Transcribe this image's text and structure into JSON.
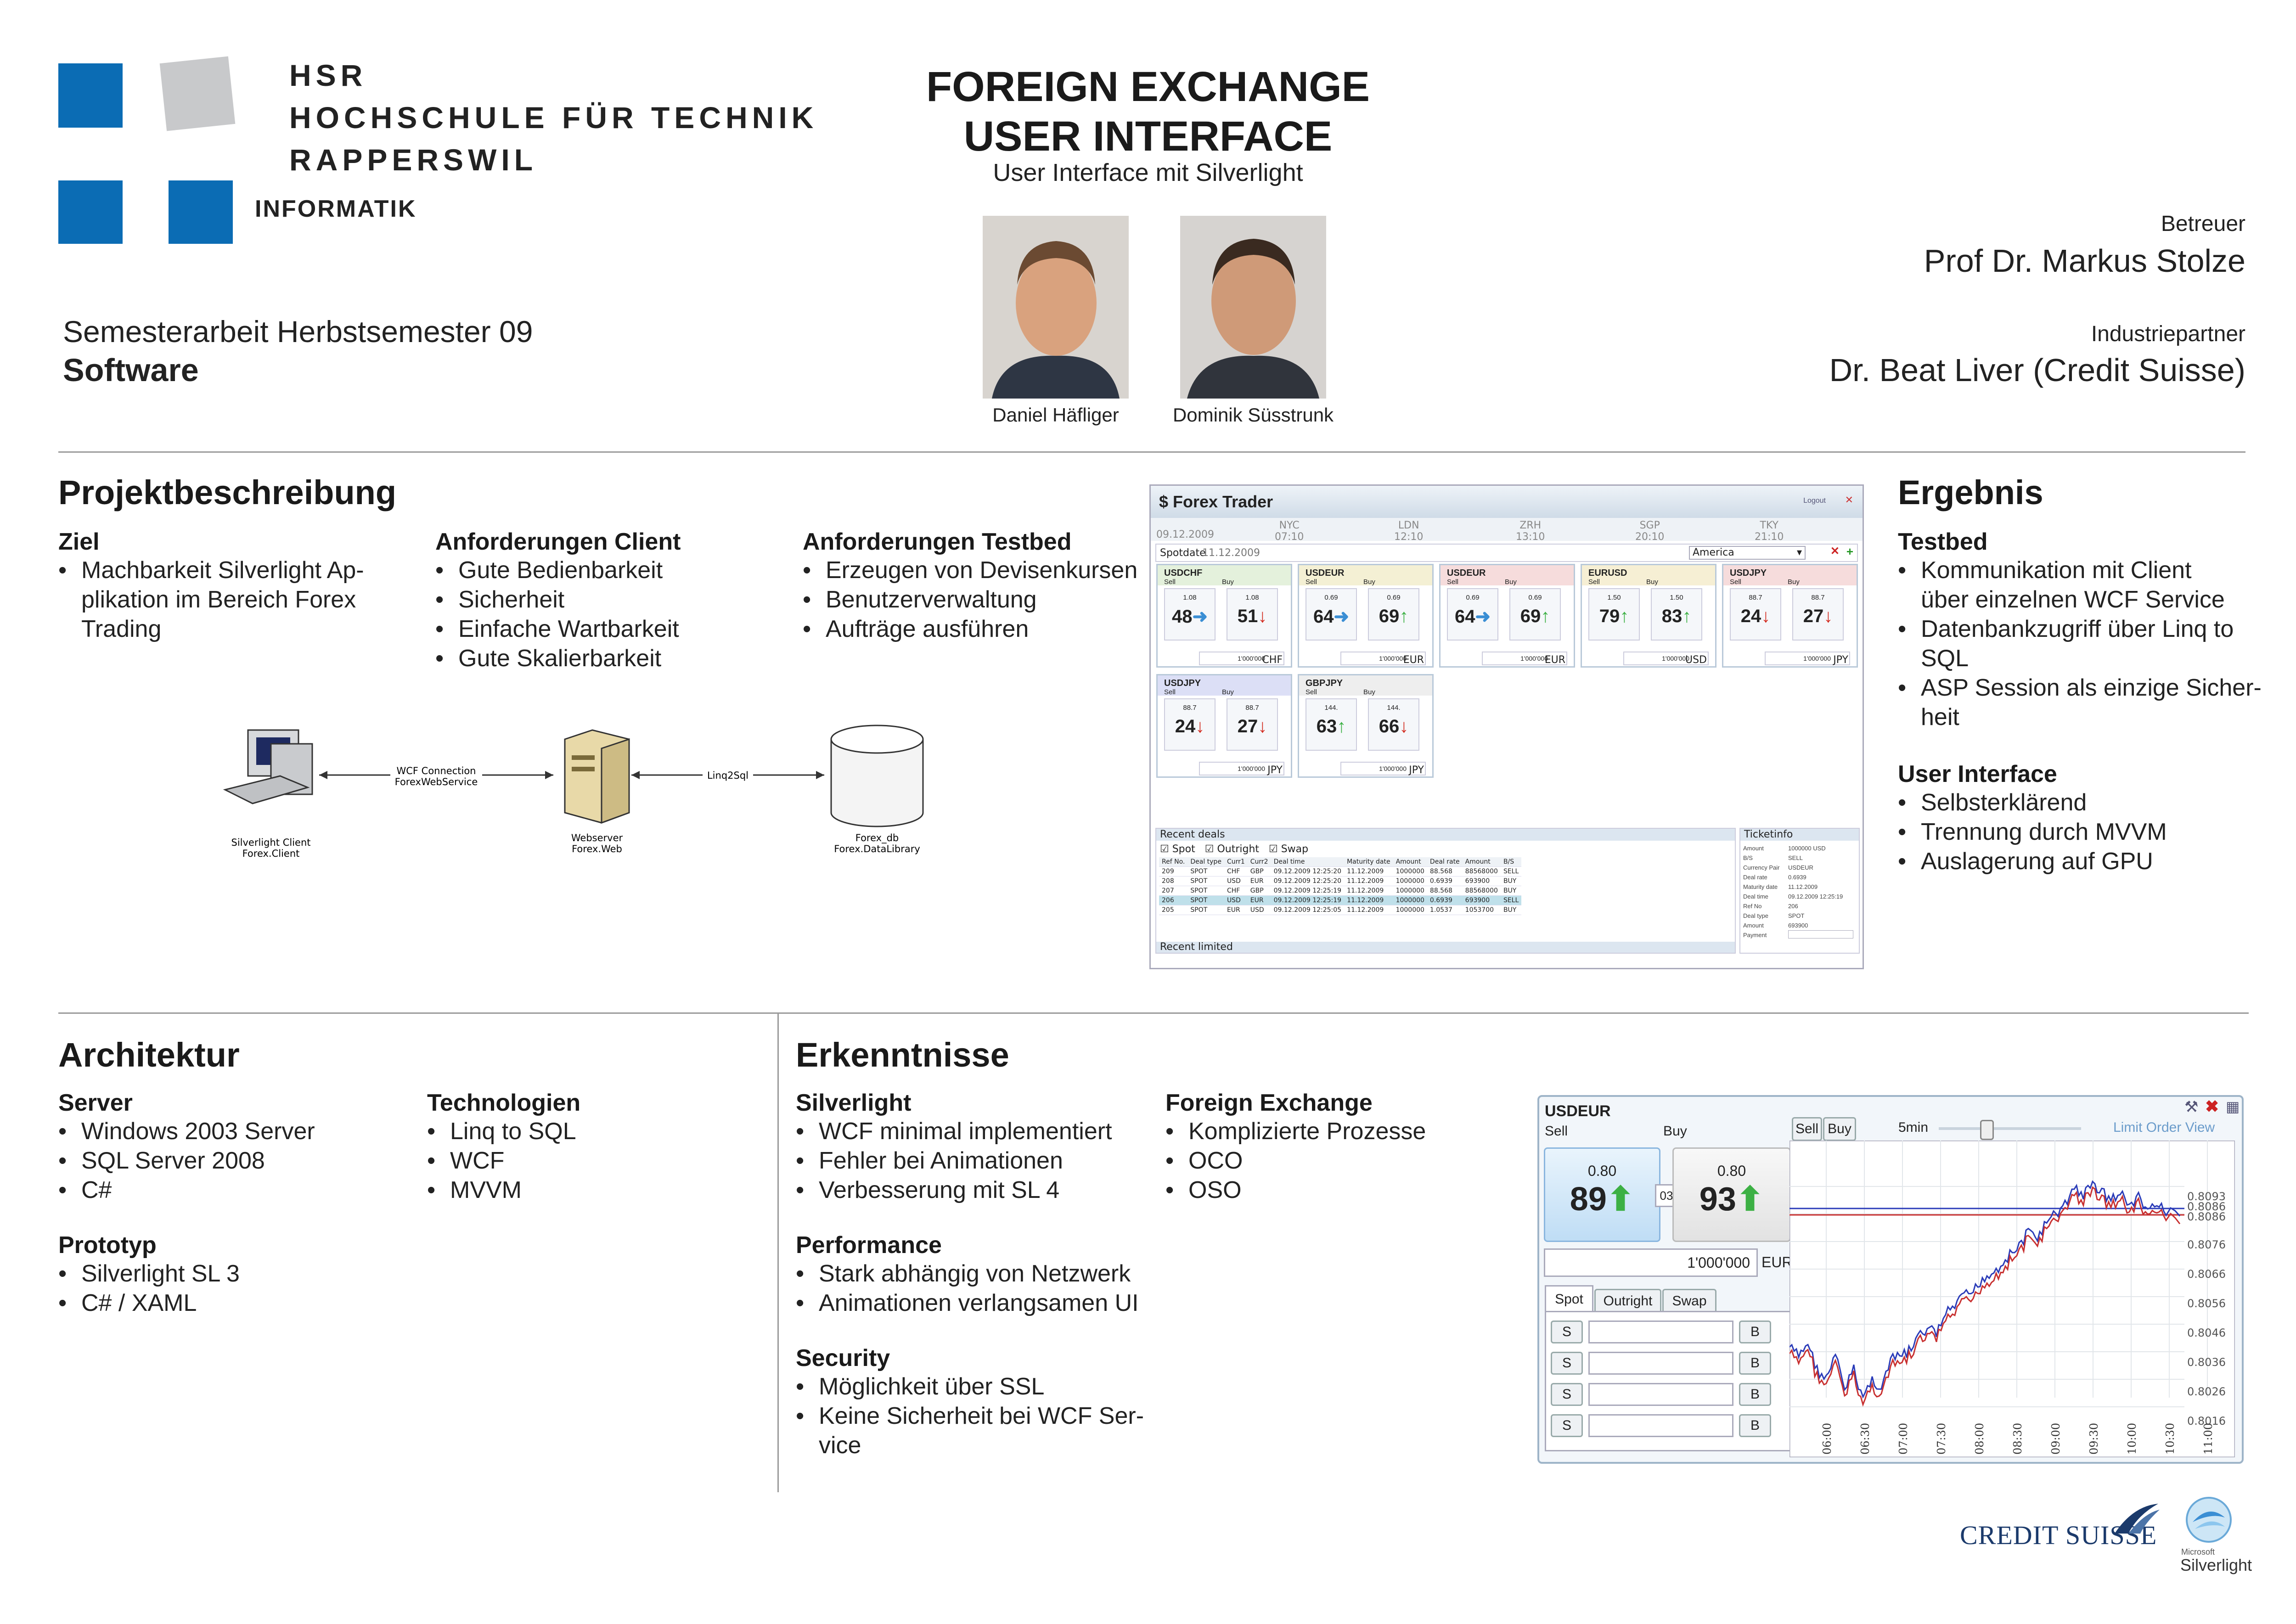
{
  "header": {
    "school_line1": "HSR",
    "school_line2": "HOCHSCHULE FÜR TECHNIK",
    "school_line3": "RAPPERSWIL",
    "department": "INFORMATIK",
    "semester": "Semesterarbeit Herbstsemester 09",
    "category": "Software",
    "title_line1": "FOREIGN EXCHANGE",
    "title_line2": "USER INTERFACE",
    "subtitle": "User Interface mit Silverlight",
    "author1": "Daniel Häfliger",
    "author2": "Dominik Süsstrunk",
    "supervisor_label": "Betreuer",
    "supervisor": "Prof Dr. Markus Stolze",
    "partner_label": "Industriepartner",
    "partner": "Dr. Beat Liver (Credit Suisse)"
  },
  "projekt": {
    "heading": "Projektbeschreibung",
    "ziel_title": "Ziel",
    "ziel_items": [
      "Machbarkeit Silverlight Ap-",
      "plikation im Bereich Forex",
      "Trading"
    ],
    "client_title": "Anforderungen Client",
    "client_items": [
      "Gute Bedienbarkeit",
      "Sicherheit",
      "Einfache Wartbarkeit",
      "Gute Skalierbarkeit"
    ],
    "testbed_title": "Anforderungen Testbed",
    "testbed_items": [
      "Erzeugen von Devisenkursen",
      "Benutzerverwaltung",
      "Aufträge ausführen"
    ]
  },
  "diagram": {
    "client_label1": "Silverlight Client",
    "client_label2": "Forex.Client",
    "wcf_label1": "WCF Connection",
    "wcf_label2": "ForexWebService",
    "server_label1": "Webserver",
    "server_label2": "Forex.Web",
    "linq_label": "Linq2Sql",
    "db_label1": "Forex_db",
    "db_label2": "Forex.DataLibrary"
  },
  "forex_trader": {
    "title": "$ Forex Trader",
    "logout": "Logout",
    "cities": [
      "NYC",
      "LDN",
      "ZRH",
      "SGP",
      "TKY"
    ],
    "times": [
      "07:10",
      "12:10",
      "13:10",
      "20:10",
      "21:10"
    ],
    "date": "09.12.2009",
    "spotdate_label": "Spotdate",
    "spotdate": "11.12.2009",
    "region": "America",
    "sell": "Sell",
    "buy": "Buy",
    "amount": "1'000'000",
    "tiles": [
      {
        "pair": "USDCHF",
        "sell_small": "1.08",
        "sell_big": "48",
        "buy_small": "1.08",
        "buy_big": "51",
        "spread": "02",
        "ccy": "CHF"
      },
      {
        "pair": "USDEUR",
        "sell_small": "0.69",
        "sell_big": "64",
        "buy_small": "0.69",
        "buy_big": "69",
        "spread": "04",
        "ccy": "EUR"
      },
      {
        "pair": "USDEUR",
        "sell_small": "0.69",
        "sell_big": "64",
        "buy_small": "0.69",
        "buy_big": "69",
        "spread": "04",
        "ccy": "EUR"
      },
      {
        "pair": "EURUSD",
        "sell_small": "1.50",
        "sell_big": "79",
        "buy_small": "1.50",
        "buy_big": "83",
        "spread": "03",
        "ccy": "USD"
      },
      {
        "pair": "USDJPY",
        "sell_small": "88.7",
        "sell_big": "24",
        "buy_small": "88.7",
        "buy_big": "27",
        "spread": "30",
        "ccy": "JPY"
      },
      {
        "pair": "USDJPY",
        "sell_small": "88.7",
        "sell_big": "24",
        "buy_small": "88.7",
        "buy_big": "27",
        "spread": "30",
        "ccy": "JPY"
      },
      {
        "pair": "GBPJPY",
        "sell_small": "144.",
        "sell_big": "63",
        "buy_small": "144.",
        "buy_big": "66",
        "spread": "00",
        "ccy": "JPY"
      }
    ],
    "recent_deals": "Recent deals",
    "filters": [
      "Spot",
      "Outright",
      "Swap"
    ],
    "deal_columns": [
      "Ref No.",
      "Deal type",
      "Curr1",
      "Curr2",
      "Deal time",
      "Maturity date",
      "Amount",
      "Deal rate",
      "Amount",
      "B/S"
    ],
    "deal_rows": [
      [
        "209",
        "SPOT",
        "CHF",
        "GBP",
        "09.12.2009 12:25:20",
        "11.12.2009",
        "1000000",
        "88.568",
        "88568000",
        "SELL"
      ],
      [
        "208",
        "SPOT",
        "USD",
        "EUR",
        "09.12.2009 12:25:20",
        "11.12.2009",
        "1000000",
        "0.6939",
        "693900",
        "BUY"
      ],
      [
        "207",
        "SPOT",
        "CHF",
        "GBP",
        "09.12.2009 12:25:19",
        "11.12.2009",
        "1000000",
        "88.568",
        "88568000",
        "BUY"
      ],
      [
        "206",
        "SPOT",
        "USD",
        "EUR",
        "09.12.2009 12:25:19",
        "11.12.2009",
        "1000000",
        "0.6939",
        "693900",
        "SELL"
      ],
      [
        "205",
        "SPOT",
        "EUR",
        "USD",
        "09.12.2009 12:25:05",
        "11.12.2009",
        "1000000",
        "1.0537",
        "1053700",
        "BUY"
      ]
    ],
    "recent_limited": "Recent limited",
    "ticket_title": "Ticketinfo",
    "ticket_labels": [
      "Amount",
      "B/S",
      "Currency Pair",
      "Deal rate",
      "Maturity date",
      "Deal time",
      "Ref No",
      "Deal type",
      "Amount",
      "Payment"
    ],
    "ticket_values": [
      "1000000 USD",
      "SELL",
      "USDEUR",
      "0.6939",
      "11.12.2009",
      "09.12.2009 12:25:19",
      "206",
      "SPOT",
      "693900",
      ""
    ]
  },
  "ergebnis": {
    "heading": "Ergebnis",
    "testbed_title": "Testbed",
    "testbed_items": [
      {
        "l1": "Kommunikation mit Client",
        "l2": "über einzelnen WCF Service"
      },
      {
        "l1": "Datenbankzugriff über Linq to",
        "l2": "SQL"
      },
      {
        "l1": "ASP Session als einzige Sicher-",
        "l2": "heit"
      }
    ],
    "ui_title": "User Interface",
    "ui_items": [
      "Selbsterklärend",
      "Trennung durch MVVM",
      "Auslagerung auf GPU"
    ]
  },
  "architektur": {
    "heading": "Architektur",
    "server_title": "Server",
    "server_items": [
      "Windows 2003 Server",
      "SQL Server 2008",
      "C#"
    ],
    "tech_title": "Technologien",
    "tech_items": [
      "Linq to SQL",
      "WCF",
      "MVVM"
    ],
    "proto_title": "Prototyp",
    "proto_items": [
      "Silverlight SL 3",
      "C# / XAML"
    ]
  },
  "erkenntnisse": {
    "heading": "Erkenntnisse",
    "sl_title": "Silverlight",
    "sl_items": [
      "WCF minimal implementiert",
      "Fehler bei Animationen",
      "Verbesserung mit SL 4"
    ],
    "perf_title": "Performance",
    "perf_items": [
      "Stark abhängig von Netzwerk",
      "Animationen verlangsamen UI"
    ],
    "sec_title": "Security",
    "sec_items": [
      {
        "l1": "Möglichkeit über SSL"
      },
      {
        "l1": "Keine Sicherheit bei WCF Ser-",
        "l2": "vice"
      }
    ],
    "fx_title": "Foreign Exchange",
    "fx_items": [
      "Komplizierte Prozesse",
      "OCO",
      "OSO"
    ]
  },
  "limit_order_view": {
    "pair": "USDEUR",
    "sell": "Sell",
    "buy": "Buy",
    "sell_btn": "Sell",
    "buy_btn": "Buy",
    "interval": "5min",
    "view_label": "Limit Order View",
    "sell_small": "0.80",
    "sell_big": "89",
    "buy_small": "0.80",
    "buy_big": "93",
    "spread": "03",
    "amount": "1'000'000",
    "currency": "EUR",
    "tabs": [
      "Spot",
      "Outright",
      "Swap"
    ],
    "row_s": "S",
    "row_b": "B",
    "y_ticks": [
      "0.8093",
      "0.8086",
      "0.8086",
      "0.8076",
      "0.8066",
      "0.8056",
      "0.8046",
      "0.8036",
      "0.8026",
      "0.8016"
    ],
    "x_ticks": [
      "06:00",
      "06:30",
      "07:00",
      "07:30",
      "08:00",
      "08:30",
      "09:00",
      "09:30",
      "10:00",
      "10:30",
      "11:00"
    ]
  },
  "logos": {
    "credit_suisse": "CREDIT SUISSE",
    "ms": "Microsoft",
    "silverlight": "Silverlight"
  },
  "colors": {
    "hsr_blue": "#0b6cb4",
    "cs_blue": "#1b3a6b",
    "up_green": "#3cb044",
    "down_red": "#d22a1e"
  }
}
